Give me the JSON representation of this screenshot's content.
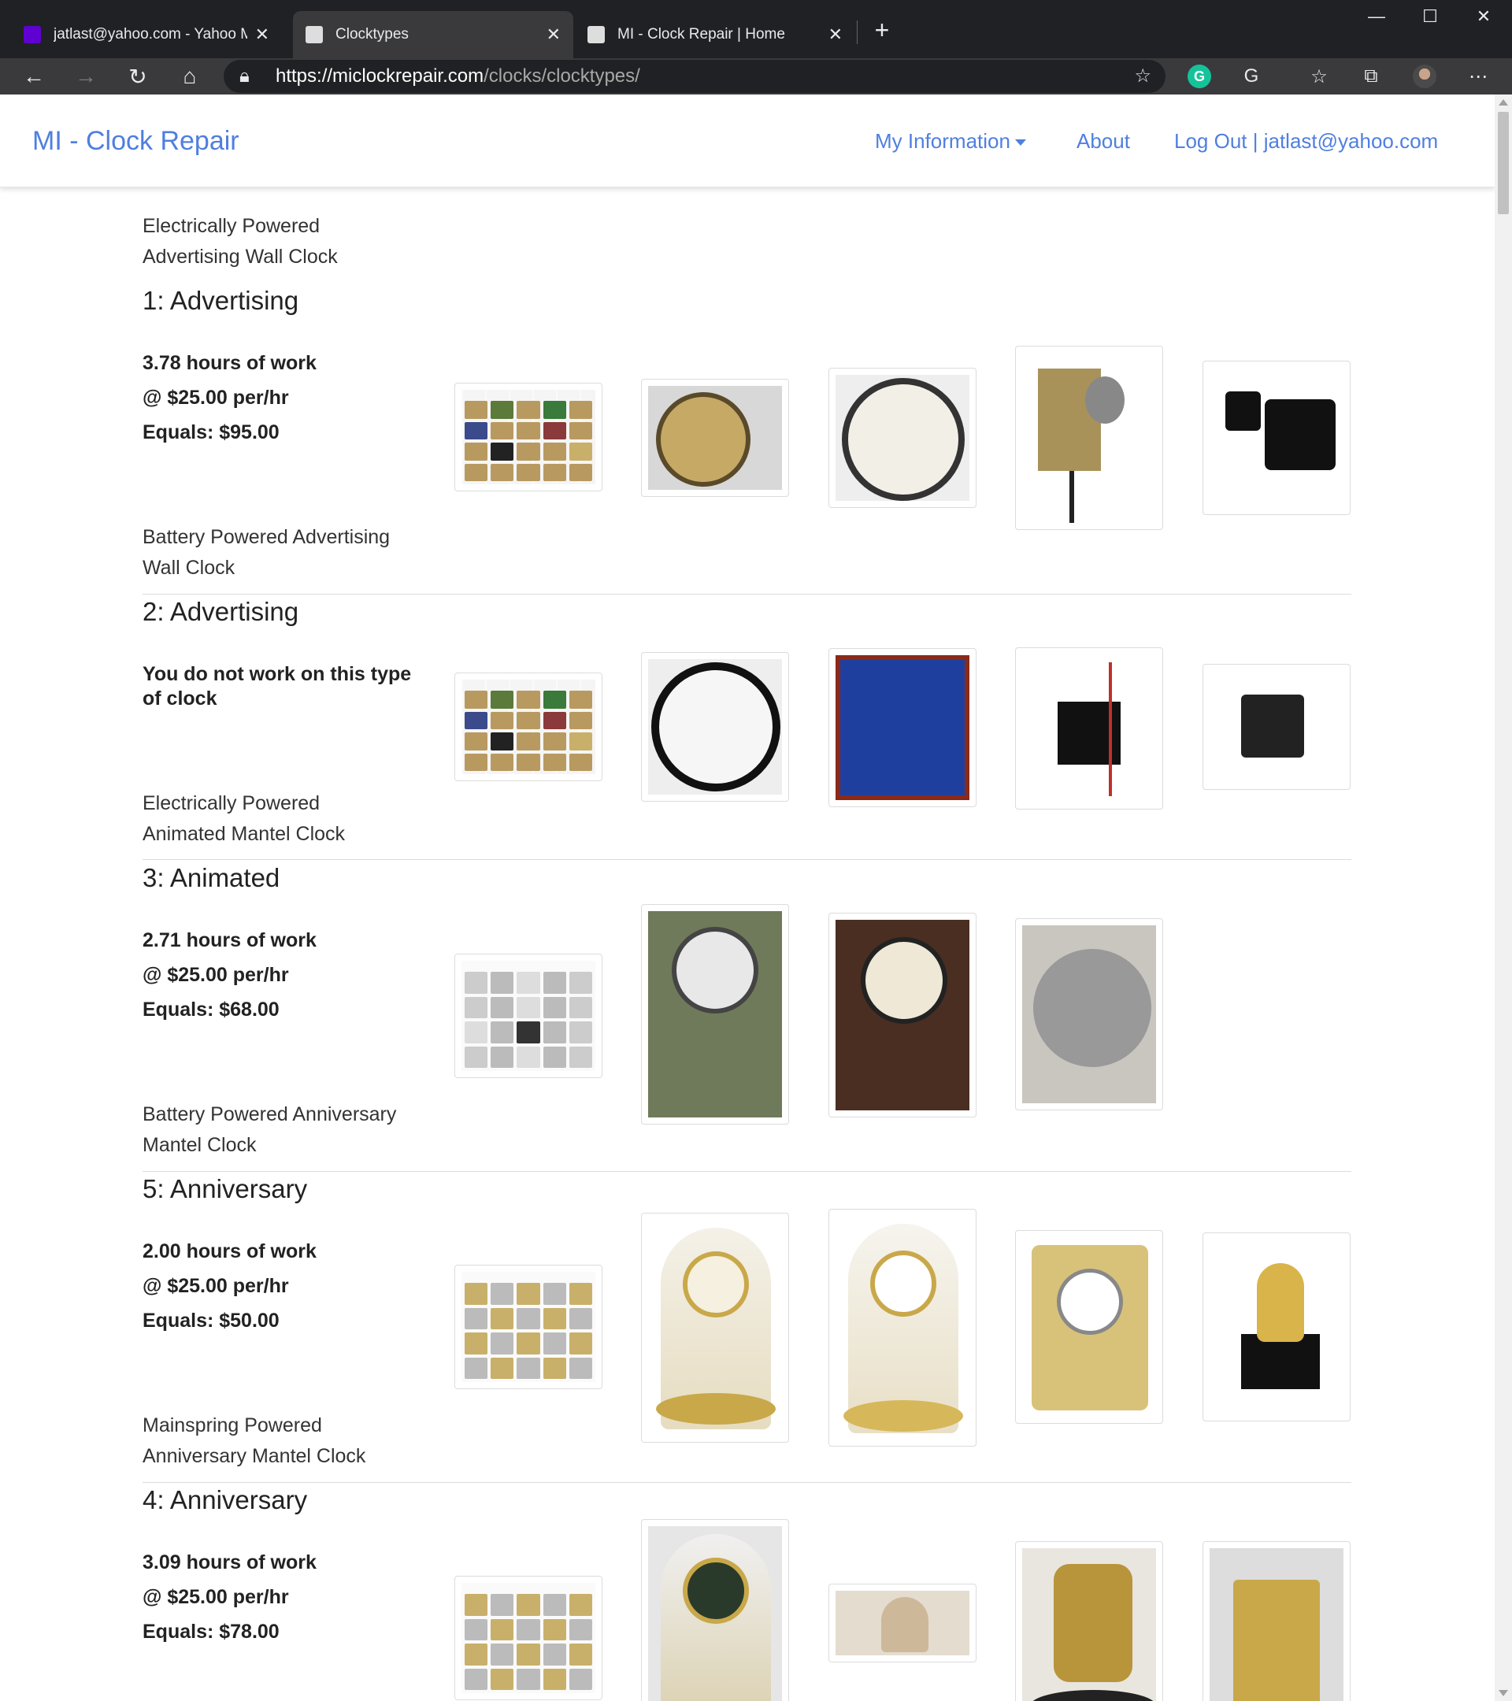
{
  "browser": {
    "tabs": [
      {
        "label": "jatlast@yahoo.com - Yahoo Mail",
        "favicon": "yahoo-mail-icon"
      },
      {
        "label": "Clocktypes",
        "favicon": "site-icon"
      },
      {
        "label": "MI - Clock Repair | Home",
        "favicon": "site-icon"
      }
    ],
    "url_host": "https://miclockrepair.com",
    "url_path": "/clocks/clocktypes/"
  },
  "navbar": {
    "brand": "MI - Clock Repair",
    "my_information": "My Information",
    "about": "About",
    "logout": "Log Out | jatlast@yahoo.com"
  },
  "colors": {
    "link": "#4f7fdf",
    "chrome_dark": "#202124",
    "chrome_toolbar": "#3a3a3c"
  },
  "sections": [
    {
      "description": "Electrically Powered Advertising Wall Clock",
      "type": "1: Advertising",
      "hours": "3.78 hours of work",
      "rate": "@ $25.00 per/hr",
      "total": "Equals: $95.00"
    },
    {
      "description": "Battery Powered Advertising Wall Clock",
      "type": "2: Advertising",
      "note": "You do not work on this type of clock"
    },
    {
      "description": "Electrically Powered Animated Mantel Clock",
      "type": "3: Animated",
      "hours": "2.71 hours of work",
      "rate": "@ $25.00 per/hr",
      "total": "Equals: $68.00"
    },
    {
      "description": "Battery Powered Anniversary Mantel Clock",
      "type": "5: Anniversary",
      "hours": "2.00 hours of work",
      "rate": "@ $25.00 per/hr",
      "total": "Equals: $50.00"
    },
    {
      "description": "Mainspring Powered Anniversary Mantel Clock",
      "type": "4: Anniversary",
      "hours": "3.09 hours of work",
      "rate": "@ $25.00 per/hr",
      "total": "Equals: $78.00"
    }
  ]
}
